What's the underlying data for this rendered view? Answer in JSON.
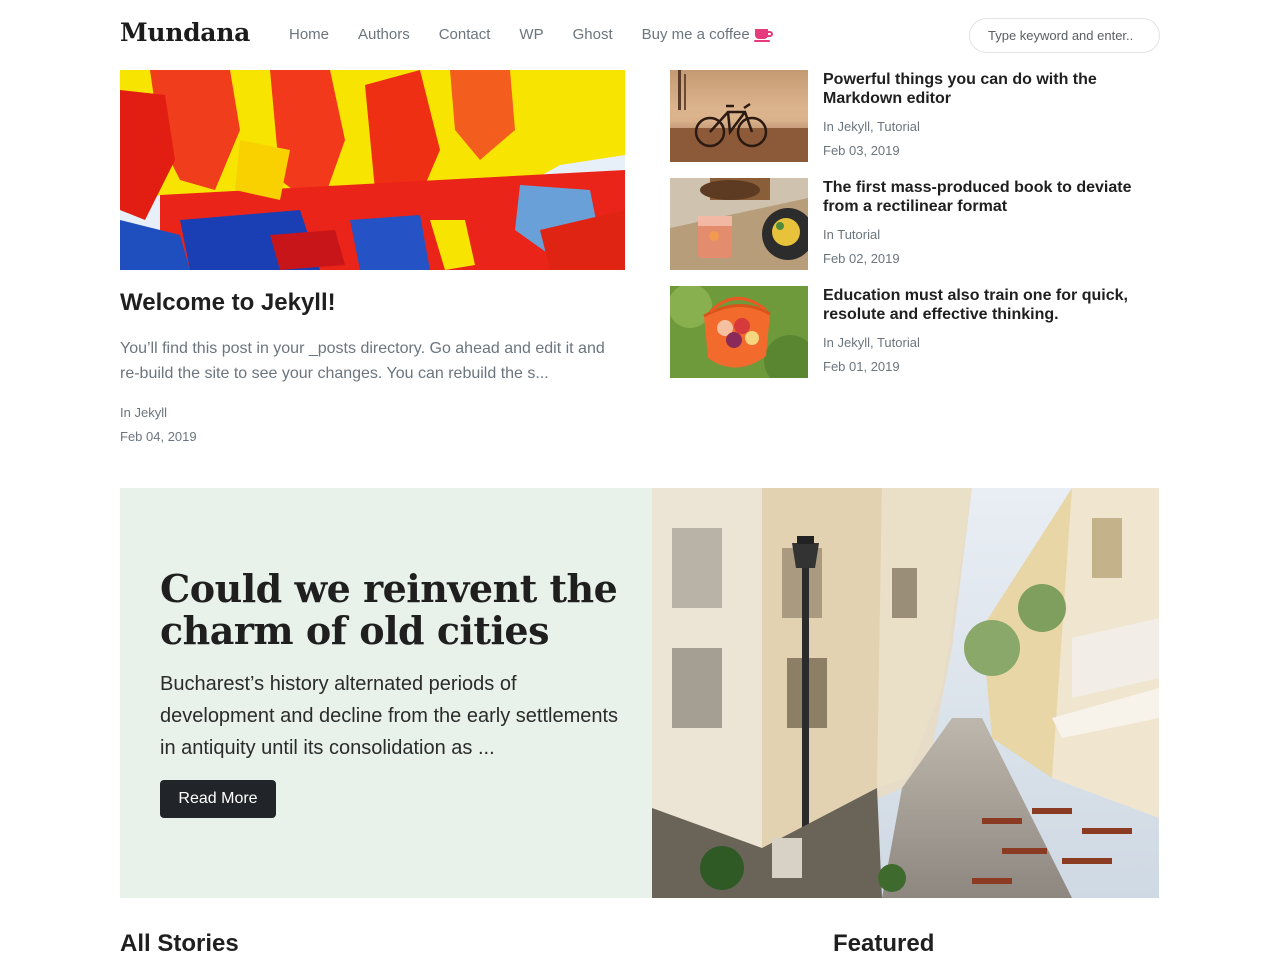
{
  "brand": "Mundana",
  "nav": {
    "items": [
      "Home",
      "Authors",
      "Contact",
      "WP",
      "Ghost"
    ],
    "coffee_label": "Buy me a coffee"
  },
  "search": {
    "placeholder": "Type keyword and enter.."
  },
  "hero_post": {
    "title": "Welcome to Jekyll!",
    "excerpt": "You’ll find this post in your _posts directory. Go ahead and edit it and re-build the site to see your changes. You can rebuild the s...",
    "category_prefix": "In",
    "category": "Jekyll",
    "date": "Feb 04, 2019"
  },
  "side_posts": [
    {
      "title": "Powerful things you can do with the Markdown editor",
      "category_prefix": "In",
      "categories": "Jekyll, Tutorial",
      "date": "Feb 03, 2019"
    },
    {
      "title": "The first mass-produced book to deviate from a rectilinear format",
      "category_prefix": "In",
      "categories": "Tutorial",
      "date": "Feb 02, 2019"
    },
    {
      "title": "Education must also train one for quick, resolute and effective thinking.",
      "category_prefix": "In",
      "categories": "Jekyll, Tutorial",
      "date": "Feb 01, 2019"
    }
  ],
  "featured_banner": {
    "title": "Could we reinvent the charm of old cities",
    "text": "Bucharest’s history alternated periods of development and decline from the early settlements in antiquity until its consolidation as ...",
    "button": "Read More"
  },
  "sections": {
    "all_stories": "All Stories",
    "featured": "Featured"
  },
  "colors": {
    "accent": "#e63c7e",
    "banner_bg": "#e8f1ea",
    "button_bg": "#212529",
    "muted_text": "#6c757d"
  }
}
